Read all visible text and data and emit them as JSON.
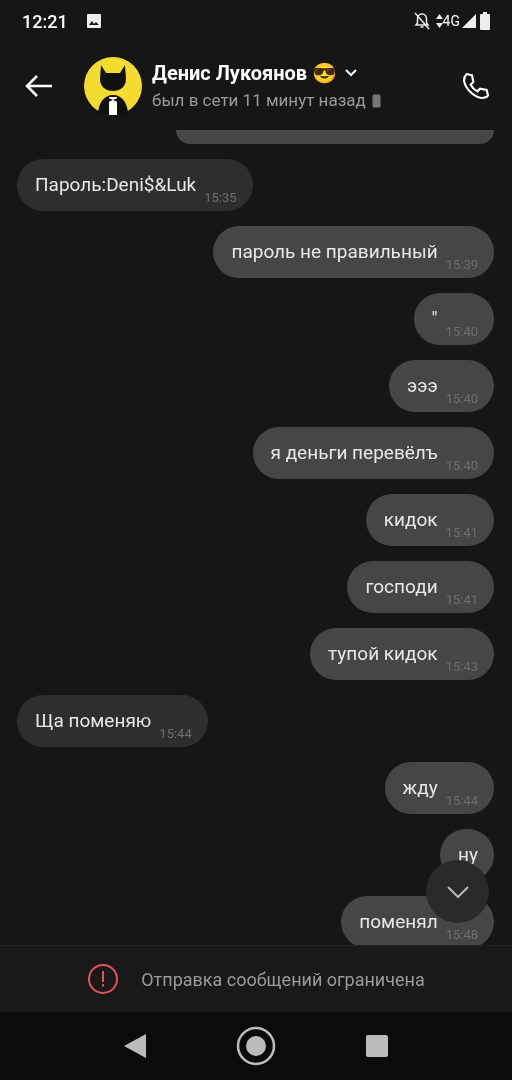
{
  "status_bar": {
    "time": "12:21",
    "network": "4G"
  },
  "header": {
    "name": "Денис Лукоянов 😎",
    "status": "был в сети 11 минут назад"
  },
  "messages": [
    {
      "kind": "partial",
      "incoming": false
    },
    {
      "kind": "text",
      "incoming": true,
      "text": "Пароль:Deni$&Luk",
      "time": "15:35"
    },
    {
      "kind": "text",
      "incoming": false,
      "text": "пароль не правильный",
      "time": "15:39"
    },
    {
      "kind": "text",
      "incoming": false,
      "text": "\"",
      "time": "15:40"
    },
    {
      "kind": "text",
      "incoming": false,
      "text": "эээ",
      "time": "15:40"
    },
    {
      "kind": "text",
      "incoming": false,
      "text": "я деньги перевёлъ",
      "time": "15:40"
    },
    {
      "kind": "text",
      "incoming": false,
      "text": "кидок",
      "time": "15:41"
    },
    {
      "kind": "text",
      "incoming": false,
      "text": "господи",
      "time": "15:41"
    },
    {
      "kind": "text",
      "incoming": false,
      "text": "тупой кидок",
      "time": "15:43"
    },
    {
      "kind": "text",
      "incoming": true,
      "text": "Ща поменяю",
      "time": "15:44"
    },
    {
      "kind": "text",
      "incoming": false,
      "text": "жду",
      "time": "15:44"
    },
    {
      "kind": "text",
      "incoming": false,
      "text": "ну"
    },
    {
      "kind": "text",
      "incoming": false,
      "text": "поменял",
      "time": "15:48"
    }
  ],
  "banner": {
    "text": "Отправка сообщений ограничена"
  }
}
